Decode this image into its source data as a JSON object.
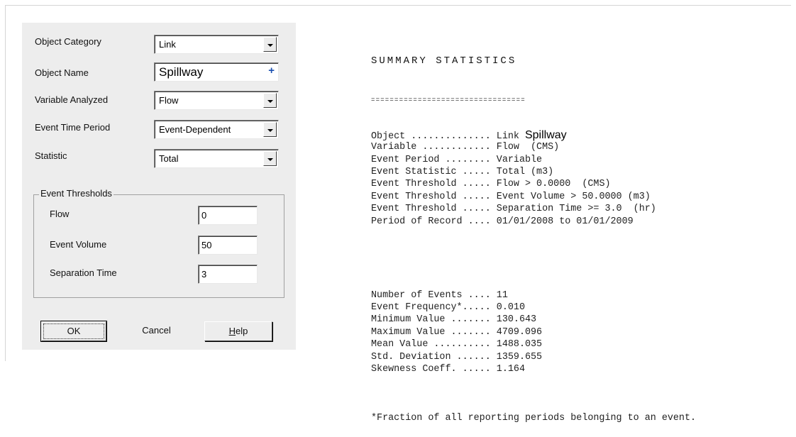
{
  "dialog": {
    "fields": [
      {
        "label": "Object Category",
        "value": "Link",
        "control": "dropdown"
      },
      {
        "label": "Object Name",
        "value": "Spillway",
        "control": "plus"
      },
      {
        "label": "Variable Analyzed",
        "value": "Flow",
        "control": "dropdown"
      },
      {
        "label": "Event Time Period",
        "value": "Event-Dependent",
        "control": "dropdown"
      },
      {
        "label": "Statistic",
        "value": "Total",
        "control": "dropdown"
      }
    ],
    "thresholds": {
      "group_label": "Event Thresholds",
      "flow_label": "Flow",
      "flow_value": "0",
      "volume_label": "Event Volume",
      "volume_value": "50",
      "separation_label": "Separation Time",
      "separation_value": "3"
    },
    "buttons": {
      "ok": "OK",
      "cancel": "Cancel",
      "help_prefix": "H",
      "help_rest": "elp"
    }
  },
  "summary": {
    "title": "SUMMARY STATISTICS",
    "rule": "=================================",
    "rows1": [
      {
        "key": "Object ..............",
        "value": "Link ",
        "value2": "Spillway"
      },
      {
        "key": "Variable ............",
        "value": "Flow  (CMS)"
      },
      {
        "key": "Event Period ........",
        "value": "Variable"
      },
      {
        "key": "Event Statistic .....",
        "value": "Total (m3)"
      },
      {
        "key": "Event Threshold .....",
        "value": "Flow > 0.0000  (CMS)"
      },
      {
        "key": "Event Threshold .....",
        "value": "Event Volume > 50.0000 (m3)"
      },
      {
        "key": "Event Threshold .....",
        "value": "Separation Time >= 3.0  (hr)"
      },
      {
        "key": "Period of Record ....",
        "value": "01/01/2008 to 01/01/2009"
      }
    ],
    "rows2": [
      {
        "key": "Number of Events ....",
        "value": "11"
      },
      {
        "key": "Event Frequency*.....",
        "value": "0.010"
      },
      {
        "key": "Minimum Value .......",
        "value": "130.643"
      },
      {
        "key": "Maximum Value .......",
        "value": "4709.096"
      },
      {
        "key": "Mean Value ..........",
        "value": "1488.035"
      },
      {
        "key": "Std. Deviation ......",
        "value": "1359.655"
      },
      {
        "key": "Skewness Coeff. .....",
        "value": "1.164"
      }
    ],
    "footnote": "*Fraction of all reporting periods belonging to an event."
  }
}
